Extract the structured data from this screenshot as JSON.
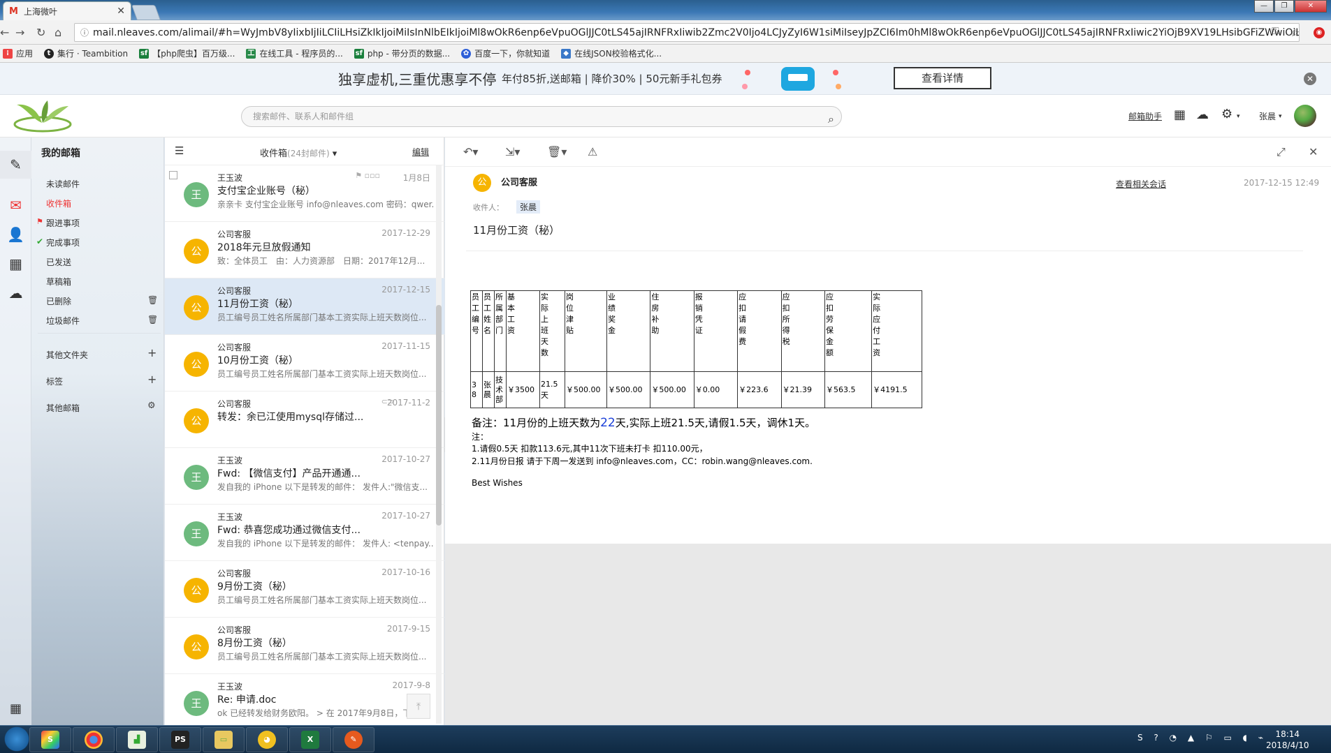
{
  "browser": {
    "tab_title": "上海微叶",
    "url": "mail.nleaves.com/alimail/#h=WyJmbV8yIixbIjIiLCIiLHsiZkIkIjoiMiIsInNlbEIkIjoiMl8wOkR6enp6eVpuOGlJJC0tLS45ajIRNFRxIiwib2Zmc2V0Ijo4LCJyZyI6W1siMiIseyJpZCI6Im0hMl8wOkR6enp6eVpuOGlJJC0tLS45ajIRNFRxIiwic2YiOjB9XV19LHsibGFiZWwiOiL...",
    "bookmarks": [
      "应用",
      "集行 · Teambition",
      "【php爬虫】百万级...",
      "在线工具 - 程序员的...",
      "php - 带分页的数据...",
      "百度一下，你就知道",
      "在线JSON校验格式化..."
    ]
  },
  "promo": {
    "headline": "独享虚机,三重优惠享不停",
    "details": "年付85折,送邮箱 | 降价30% | 50元新手礼包券",
    "button": "查看详情"
  },
  "header": {
    "search_placeholder": "搜索邮件、联系人和邮件组",
    "assistant": "邮箱助手",
    "user": "张晨"
  },
  "nav": {
    "title": "我的邮箱",
    "items": [
      "未读邮件",
      "收件箱",
      "跟进事项",
      "完成事项",
      "已发送",
      "草稿箱",
      "已删除",
      "垃圾邮件"
    ],
    "other_folders": "其他文件夹",
    "tags": "标签",
    "other_mail": "其他邮箱"
  },
  "list": {
    "folder": "收件箱",
    "count": "(24封邮件)",
    "edit": "编辑",
    "rows": [
      {
        "avatar": "王",
        "name": "王玉波",
        "date": "1月8日",
        "subject": "支付宝企业账号（秘）",
        "preview": "亲亲卡 支付宝企业账号 info@nleaves.com 密码：qwer...",
        "color": "#6dba7e"
      },
      {
        "avatar": "公",
        "name": "公司客服",
        "date": "2017-12-29",
        "subject": "2018年元旦放假通知",
        "preview": "致：全体员工　由：人力资源部　日期：2017年12月...",
        "color": "#f6b400"
      },
      {
        "avatar": "公",
        "name": "公司客服",
        "date": "2017-12-15",
        "subject": "11月份工资（秘）",
        "preview": "员工编号员工姓名所属部门基本工资实际上班天数岗位...",
        "color": "#f6b400"
      },
      {
        "avatar": "公",
        "name": "公司客服",
        "date": "2017-11-15",
        "subject": "10月份工资（秘）",
        "preview": "员工编号员工姓名所属部门基本工资实际上班天数岗位...",
        "color": "#f6b400"
      },
      {
        "avatar": "公",
        "name": "公司客服",
        "date": "2017-11-2",
        "subject": "转发：余已江使用mysql存储过...",
        "preview": "",
        "color": "#f6b400"
      },
      {
        "avatar": "王",
        "name": "王玉波",
        "date": "2017-10-27",
        "subject": "Fwd: 【微信支付】产品开通通...",
        "preview": "发自我的 iPhone 以下是转发的邮件： 发件人:\"微信支...",
        "color": "#6dba7e"
      },
      {
        "avatar": "王",
        "name": "王玉波",
        "date": "2017-10-27",
        "subject": "Fwd: 恭喜您成功通过微信支付...",
        "preview": "发自我的 iPhone 以下是转发的邮件： 发件人: <tenpay...",
        "color": "#6dba7e"
      },
      {
        "avatar": "公",
        "name": "公司客服",
        "date": "2017-10-16",
        "subject": "9月份工资（秘）",
        "preview": "员工编号员工姓名所属部门基本工资实际上班天数岗位...",
        "color": "#f6b400"
      },
      {
        "avatar": "公",
        "name": "公司客服",
        "date": "2017-9-15",
        "subject": "8月份工资（秘）",
        "preview": "员工编号员工姓名所属部门基本工资实际上班天数岗位...",
        "color": "#f6b400"
      },
      {
        "avatar": "王",
        "name": "王玉波",
        "date": "2017-9-8",
        "subject": "Re: 申请.doc",
        "preview": "ok 已经转发给财务欧阳。 > 在 2017年9月8日，下...",
        "color": "#6dba7e"
      }
    ]
  },
  "reader": {
    "from": "公司客服",
    "avatar": "公",
    "related": "查看相关会话",
    "date": "2017-12-15 12:49",
    "rcpt_label": "收件人：",
    "rcpt": "张晨",
    "subject": "11月份工资（秘）",
    "table": {
      "headers": [
        "员工编号",
        "员工姓名",
        "所属部门",
        "基本工资",
        "实际上班天数",
        "岗位津贴",
        "业绩奖金",
        "住房补助",
        "报销凭证",
        "应扣请假费",
        "应扣所得税",
        "应扣劳保金额",
        "实际应付工资"
      ],
      "row": [
        "38",
        "张晨",
        "技术部",
        "￥3500",
        "21.5天",
        "￥500.00",
        "￥500.00",
        "￥500.00",
        "￥0.00",
        "￥223.6",
        "￥21.39",
        "￥563.5",
        "￥4191.5"
      ]
    },
    "note_prefix": "备注：11月份的上班天数为",
    "note_days": "22",
    "note_suffix": "天,实际上班21.5天,请假1.5天，调休1天。",
    "note_label": "注：",
    "note1": "1.请假0.5天 扣款113.6元,其中11次下班未打卡 扣110.00元，",
    "note2": "2.11月份日报 请于下周一发送到 info@nleaves.com，CC：robin.wang@nleaves.com.",
    "sign": "Best  Wishes"
  },
  "taskbar": {
    "time": "18:14",
    "date": "2018/4/10"
  }
}
